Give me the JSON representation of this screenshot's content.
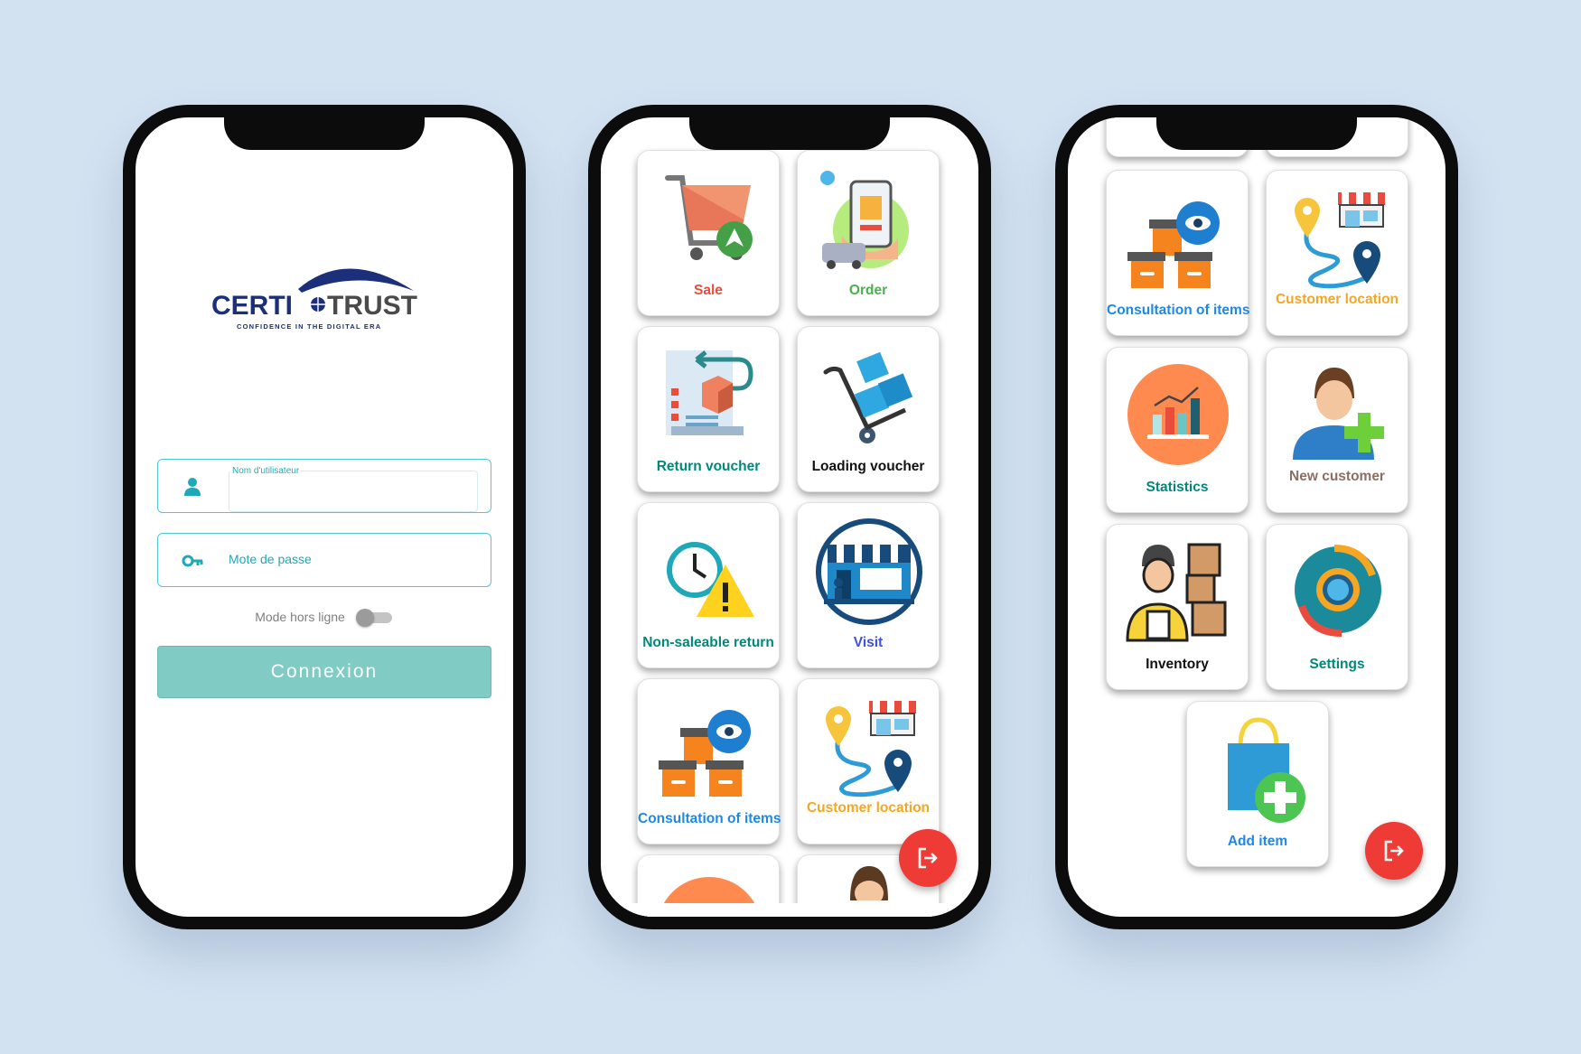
{
  "login": {
    "username_label": "Nom d'utilisateur",
    "password_placeholder": "Mote de passe",
    "offline_label": "Mode hors ligne",
    "login_button": "Connexion"
  },
  "menu_screen_1": {
    "tiles": [
      {
        "label": "Sale",
        "icon": "shopping-cart-icon",
        "color": "#e94b3c"
      },
      {
        "label": "Order",
        "icon": "mobile-order-icon",
        "color": "#4caf50"
      },
      {
        "label": "Return voucher",
        "icon": "return-document-icon",
        "color": "#00897b"
      },
      {
        "label": "Loading voucher",
        "icon": "hand-truck-icon",
        "color": "#111111"
      },
      {
        "label": "Non-saleable return",
        "icon": "clock-warning-icon",
        "color": "#00897b"
      },
      {
        "label": "Visit",
        "icon": "storefront-visit-icon",
        "color": "#3f51e4"
      },
      {
        "label": "Consultation of items",
        "icon": "boxes-eye-icon",
        "color": "#1e88e5"
      },
      {
        "label": "Customer location",
        "icon": "map-route-icon",
        "color": "#f5a623"
      }
    ]
  },
  "menu_screen_2": {
    "tiles": [
      {
        "label": "Consultation of items",
        "icon": "boxes-eye-icon",
        "color": "#1e88e5"
      },
      {
        "label": "Customer location",
        "icon": "map-route-icon",
        "color": "#f5a623"
      },
      {
        "label": "Statistics",
        "icon": "chart-icon",
        "color": "#00897b"
      },
      {
        "label": "New customer",
        "icon": "add-user-icon",
        "color": "#8d6e63"
      },
      {
        "label": "Inventory",
        "icon": "warehouse-worker-icon",
        "color": "#111111"
      },
      {
        "label": "Settings",
        "icon": "settings-gear-icon",
        "color": "#00897b"
      },
      {
        "label": "Add item",
        "icon": "add-bag-icon",
        "color": "#1e88e5"
      }
    ]
  },
  "logout_icon": "logout-icon"
}
